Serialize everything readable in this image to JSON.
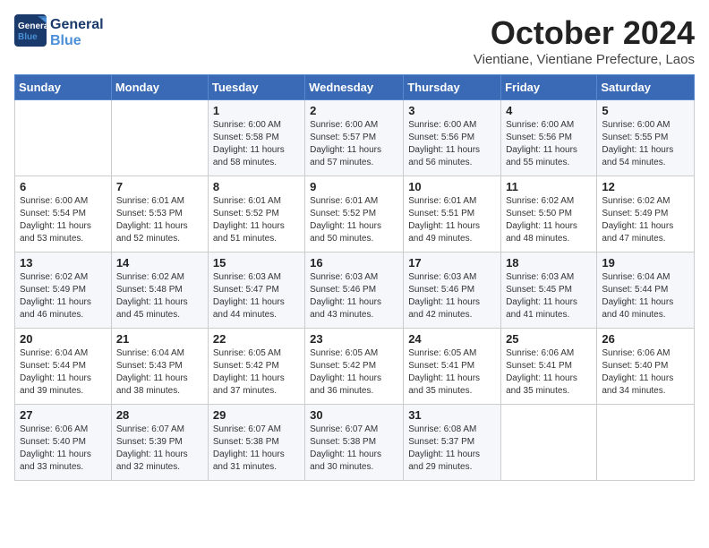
{
  "logo": {
    "line1": "General",
    "line2": "Blue"
  },
  "title": "October 2024",
  "subtitle": "Vientiane, Vientiane Prefecture, Laos",
  "days_of_week": [
    "Sunday",
    "Monday",
    "Tuesday",
    "Wednesday",
    "Thursday",
    "Friday",
    "Saturday"
  ],
  "weeks": [
    [
      {
        "day": "",
        "info": ""
      },
      {
        "day": "",
        "info": ""
      },
      {
        "day": "1",
        "info": "Sunrise: 6:00 AM\nSunset: 5:58 PM\nDaylight: 11 hours and 58 minutes."
      },
      {
        "day": "2",
        "info": "Sunrise: 6:00 AM\nSunset: 5:57 PM\nDaylight: 11 hours and 57 minutes."
      },
      {
        "day": "3",
        "info": "Sunrise: 6:00 AM\nSunset: 5:56 PM\nDaylight: 11 hours and 56 minutes."
      },
      {
        "day": "4",
        "info": "Sunrise: 6:00 AM\nSunset: 5:56 PM\nDaylight: 11 hours and 55 minutes."
      },
      {
        "day": "5",
        "info": "Sunrise: 6:00 AM\nSunset: 5:55 PM\nDaylight: 11 hours and 54 minutes."
      }
    ],
    [
      {
        "day": "6",
        "info": "Sunrise: 6:00 AM\nSunset: 5:54 PM\nDaylight: 11 hours and 53 minutes."
      },
      {
        "day": "7",
        "info": "Sunrise: 6:01 AM\nSunset: 5:53 PM\nDaylight: 11 hours and 52 minutes."
      },
      {
        "day": "8",
        "info": "Sunrise: 6:01 AM\nSunset: 5:52 PM\nDaylight: 11 hours and 51 minutes."
      },
      {
        "day": "9",
        "info": "Sunrise: 6:01 AM\nSunset: 5:52 PM\nDaylight: 11 hours and 50 minutes."
      },
      {
        "day": "10",
        "info": "Sunrise: 6:01 AM\nSunset: 5:51 PM\nDaylight: 11 hours and 49 minutes."
      },
      {
        "day": "11",
        "info": "Sunrise: 6:02 AM\nSunset: 5:50 PM\nDaylight: 11 hours and 48 minutes."
      },
      {
        "day": "12",
        "info": "Sunrise: 6:02 AM\nSunset: 5:49 PM\nDaylight: 11 hours and 47 minutes."
      }
    ],
    [
      {
        "day": "13",
        "info": "Sunrise: 6:02 AM\nSunset: 5:49 PM\nDaylight: 11 hours and 46 minutes."
      },
      {
        "day": "14",
        "info": "Sunrise: 6:02 AM\nSunset: 5:48 PM\nDaylight: 11 hours and 45 minutes."
      },
      {
        "day": "15",
        "info": "Sunrise: 6:03 AM\nSunset: 5:47 PM\nDaylight: 11 hours and 44 minutes."
      },
      {
        "day": "16",
        "info": "Sunrise: 6:03 AM\nSunset: 5:46 PM\nDaylight: 11 hours and 43 minutes."
      },
      {
        "day": "17",
        "info": "Sunrise: 6:03 AM\nSunset: 5:46 PM\nDaylight: 11 hours and 42 minutes."
      },
      {
        "day": "18",
        "info": "Sunrise: 6:03 AM\nSunset: 5:45 PM\nDaylight: 11 hours and 41 minutes."
      },
      {
        "day": "19",
        "info": "Sunrise: 6:04 AM\nSunset: 5:44 PM\nDaylight: 11 hours and 40 minutes."
      }
    ],
    [
      {
        "day": "20",
        "info": "Sunrise: 6:04 AM\nSunset: 5:44 PM\nDaylight: 11 hours and 39 minutes."
      },
      {
        "day": "21",
        "info": "Sunrise: 6:04 AM\nSunset: 5:43 PM\nDaylight: 11 hours and 38 minutes."
      },
      {
        "day": "22",
        "info": "Sunrise: 6:05 AM\nSunset: 5:42 PM\nDaylight: 11 hours and 37 minutes."
      },
      {
        "day": "23",
        "info": "Sunrise: 6:05 AM\nSunset: 5:42 PM\nDaylight: 11 hours and 36 minutes."
      },
      {
        "day": "24",
        "info": "Sunrise: 6:05 AM\nSunset: 5:41 PM\nDaylight: 11 hours and 35 minutes."
      },
      {
        "day": "25",
        "info": "Sunrise: 6:06 AM\nSunset: 5:41 PM\nDaylight: 11 hours and 35 minutes."
      },
      {
        "day": "26",
        "info": "Sunrise: 6:06 AM\nSunset: 5:40 PM\nDaylight: 11 hours and 34 minutes."
      }
    ],
    [
      {
        "day": "27",
        "info": "Sunrise: 6:06 AM\nSunset: 5:40 PM\nDaylight: 11 hours and 33 minutes."
      },
      {
        "day": "28",
        "info": "Sunrise: 6:07 AM\nSunset: 5:39 PM\nDaylight: 11 hours and 32 minutes."
      },
      {
        "day": "29",
        "info": "Sunrise: 6:07 AM\nSunset: 5:38 PM\nDaylight: 11 hours and 31 minutes."
      },
      {
        "day": "30",
        "info": "Sunrise: 6:07 AM\nSunset: 5:38 PM\nDaylight: 11 hours and 30 minutes."
      },
      {
        "day": "31",
        "info": "Sunrise: 6:08 AM\nSunset: 5:37 PM\nDaylight: 11 hours and 29 minutes."
      },
      {
        "day": "",
        "info": ""
      },
      {
        "day": "",
        "info": ""
      }
    ]
  ]
}
